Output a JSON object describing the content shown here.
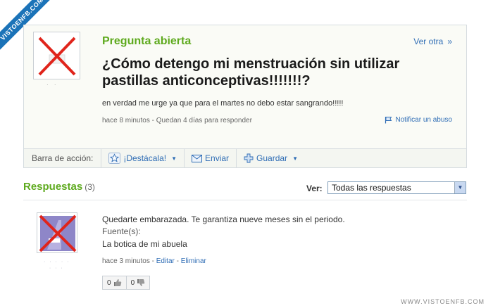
{
  "branding": {
    "ribbon": "VISTOENFB.COM",
    "footer": "WWW.VISTOENFB.COM"
  },
  "question": {
    "status": "Pregunta abierta",
    "more_label": "Ver otra",
    "more_chevron": "»",
    "title": "¿Cómo detengo mi menstruación sin utilizar pastillas anticonceptivas!!!!!!!?",
    "body": "en verdad me urge ya que para el martes no debo estar sangrando!!!!!",
    "meta": "hace 8 minutos - Quedan 4 días para responder",
    "report": "Notificar un abuso",
    "user": "· ·"
  },
  "action_bar": {
    "label": "Barra de acción:",
    "highlight": "¡Destácala!",
    "send": "Enviar",
    "save": "Guardar"
  },
  "answers": {
    "title": "Respuestas",
    "count": "(3)",
    "filter_label": "Ver:",
    "filter_value": "Todas las respuestas",
    "items": [
      {
        "text": "Quedarte embarazada. Te garantiza nueve meses sin el periodo.",
        "source_label": "Fuente(s):",
        "source": "La botica de mi abuela",
        "time": "hace 3 minutos",
        "edit": "Editar",
        "delete": "Eliminar",
        "thumbs_up": "0",
        "thumbs_down": "0"
      }
    ]
  },
  "colors": {
    "accent_green": "#5eaa1e",
    "link_blue": "#2f6db5",
    "cross_red": "#e0241b",
    "avatar_purple": "#8e86c8"
  }
}
